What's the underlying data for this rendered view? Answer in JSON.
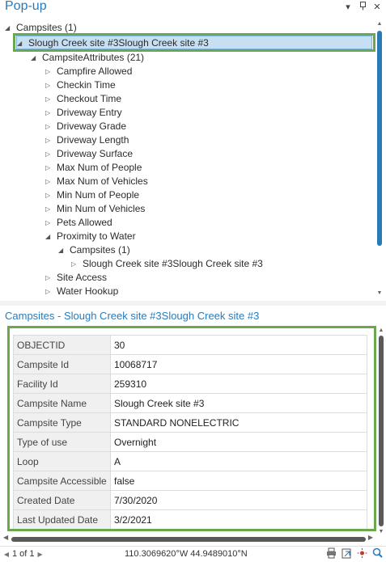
{
  "panel": {
    "title": "Pop-up",
    "menu_icon": "dropdown-arrow-icon",
    "pin_icon": "pin-icon",
    "close_icon": "close-icon"
  },
  "tree": {
    "root": "Campsites  (1)",
    "feature": "Slough Creek site #3Slough Creek site #3",
    "related_group": "CampsiteAttributes  (21)",
    "attributes": [
      "Campfire Allowed",
      "Checkin Time",
      "Checkout Time",
      "Driveway Entry",
      "Driveway Grade",
      "Driveway Length",
      "Driveway Surface",
      "Max Num of People",
      "Max Num of Vehicles",
      "Min Num of People",
      "Min Num of Vehicles",
      "Pets Allowed",
      "Proximity to Water"
    ],
    "nested_group": "Campsites  (1)",
    "nested_feature": "Slough Creek site #3Slough Creek site #3",
    "after_attributes": [
      "Site Access",
      "Water Hookup"
    ]
  },
  "details": {
    "title": "Campsites - Slough Creek site #3Slough Creek site #3",
    "rows": [
      {
        "field": "OBJECTID",
        "value": "30"
      },
      {
        "field": "Campsite Id",
        "value": "10068717"
      },
      {
        "field": "Facility Id",
        "value": "259310"
      },
      {
        "field": "Campsite Name",
        "value": "Slough Creek site #3"
      },
      {
        "field": "Campsite Type",
        "value": "STANDARD NONELECTRIC"
      },
      {
        "field": "Type of use",
        "value": "Overnight"
      },
      {
        "field": "Loop",
        "value": "A"
      },
      {
        "field": "Campsite Accessible",
        "value": "false"
      },
      {
        "field": "Created Date",
        "value": "7/30/2020"
      },
      {
        "field": "Last Updated Date",
        "value": "3/2/2021"
      }
    ]
  },
  "status": {
    "page_label": "1 of 1",
    "coordinates": "110.3069620°W 44.9489010°N",
    "tools": [
      "print-icon",
      "export-icon",
      "flash-icon",
      "zoom-to-icon"
    ]
  },
  "colors": {
    "accent": "#2a7ab8",
    "highlight_outline": "#6aa84f",
    "selection_fill": "#c7dff3"
  }
}
